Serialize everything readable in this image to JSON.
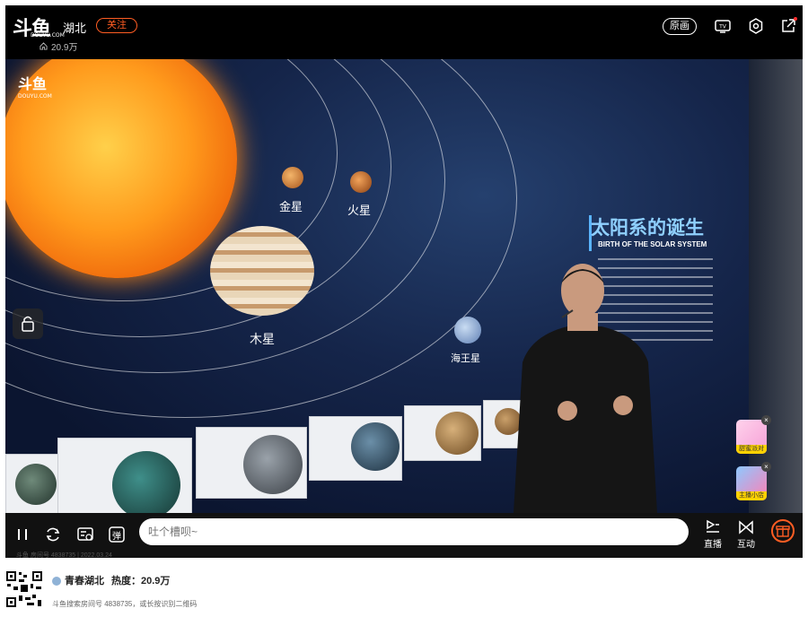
{
  "header": {
    "logo_text": "斗鱼",
    "logo_sub": "DOUYU.COM",
    "room_name": "湖北",
    "follow_label": "关注",
    "heat": "20.9万",
    "origin_label": "原画"
  },
  "video": {
    "watermark": "斗鱼",
    "watermark_sub": "DOUYU.COM",
    "planets": {
      "venus": "金星",
      "mars": "火星",
      "jupiter": "木星",
      "neptune": "海王星"
    },
    "panel_title": "太阳系的诞生",
    "panel_subtitle": "BIRTH OF THE SOLAR SYSTEM"
  },
  "side": {
    "promo1": "甜蜜派对",
    "promo2": "主播小店"
  },
  "controls": {
    "danmu_button": "弹",
    "input_placeholder": "吐个槽呗~",
    "live_label": "直播",
    "interact_label": "互动",
    "room_info": "斗鱼 房间号 4838735 | 2022.03.24"
  },
  "bottom": {
    "anchor_name": "青春湖北",
    "heat_label": "热度：20.9万",
    "hint": "斗鱼搜索房间号 4838735，或长按识别二维码"
  },
  "colors": {
    "accent": "#ff5d23",
    "background": "#000000"
  }
}
